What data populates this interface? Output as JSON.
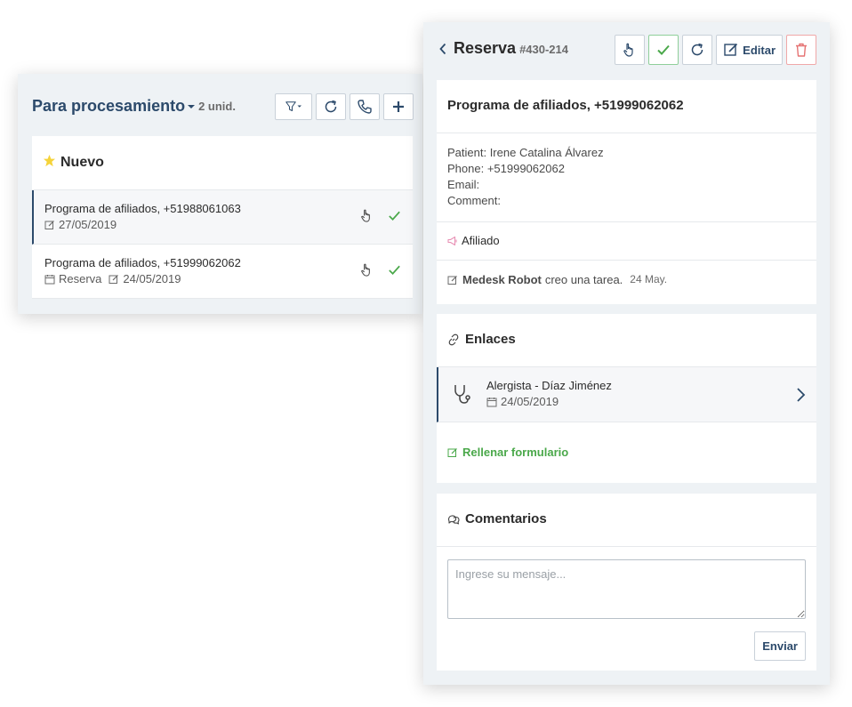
{
  "list_panel": {
    "title": "Para procesamiento",
    "count": "2 unid.",
    "group": {
      "label": "Nuevo"
    },
    "items": [
      {
        "title": "Programa de afiliados, +51988061063",
        "date": "27/05/2019"
      },
      {
        "title": "Programa de afiliados, +51999062062",
        "type": "Reserva",
        "date": "24/05/2019"
      }
    ]
  },
  "detail": {
    "title": "Reserva",
    "id": "#430-214",
    "edit_label": "Editar",
    "card_title": "Programa de afiliados, +51999062062",
    "fields": {
      "patient": "Patient: Irene Catalina Álvarez",
      "phone": "Phone: +51999062062",
      "email": "Email:",
      "comment": "Comment:"
    },
    "tag": "Afiliado",
    "activity": {
      "actor": "Medesk Robot",
      "action": "creo una tarea.",
      "date": "24 May."
    },
    "links": {
      "title": "Enlaces",
      "item": {
        "title": "Alergista - Díaz Jiménez",
        "date": "24/05/2019"
      },
      "fill_form": "Rellenar formulario"
    },
    "comments": {
      "title": "Comentarios",
      "placeholder": "Ingrese su mensaje...",
      "send_label": "Enviar"
    }
  },
  "colors": {
    "accent": "#2c4a6b",
    "success": "#4aa84a",
    "danger": "#e57373",
    "star": "#f5d33a",
    "tag": "#e88fb4"
  }
}
